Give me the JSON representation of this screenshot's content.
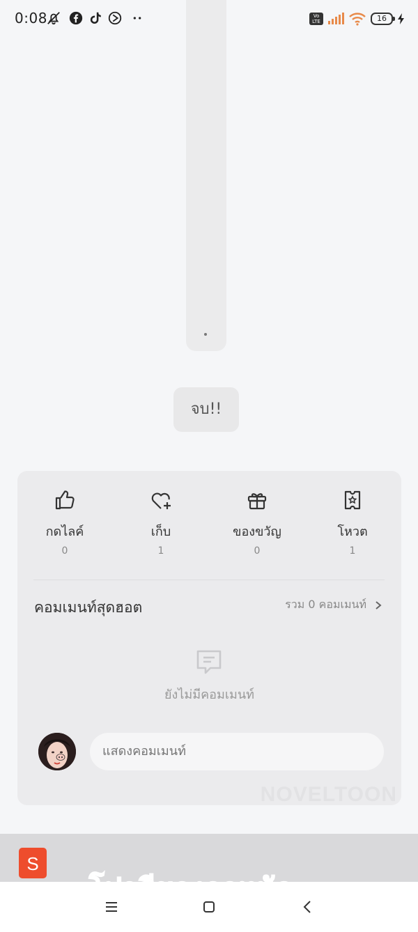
{
  "status_bar": {
    "time": "0:08",
    "volte": "Vo LTE",
    "battery": "16"
  },
  "reader": {
    "end_label": "จบ!!"
  },
  "actions": [
    {
      "label": "กดไลค์",
      "count": "0",
      "icon": "thumbs-up-icon"
    },
    {
      "label": "เก็บ",
      "count": "1",
      "icon": "heart-plus-icon"
    },
    {
      "label": "ของขวัญ",
      "count": "0",
      "icon": "gift-icon"
    },
    {
      "label": "โหวต",
      "count": "1",
      "icon": "vote-ticket-icon"
    }
  ],
  "comments": {
    "title": "คอมเมนท์สุดฮอต",
    "total": "รวม 0 คอมเมนท์",
    "empty_text": "ยังไม่มีคอมเมนท์",
    "input_placeholder": "แสดงคอมเมนท์"
  },
  "watermark": "NOVELTOON",
  "ad": {
    "logo_letter": "S",
    "headline": "โปรดีของถูกหนัก"
  },
  "colors": {
    "background": "#f5f6f8",
    "card": "#ebebed",
    "shopee": "#ee4d2d",
    "ad_text": "#ff6a2a"
  }
}
